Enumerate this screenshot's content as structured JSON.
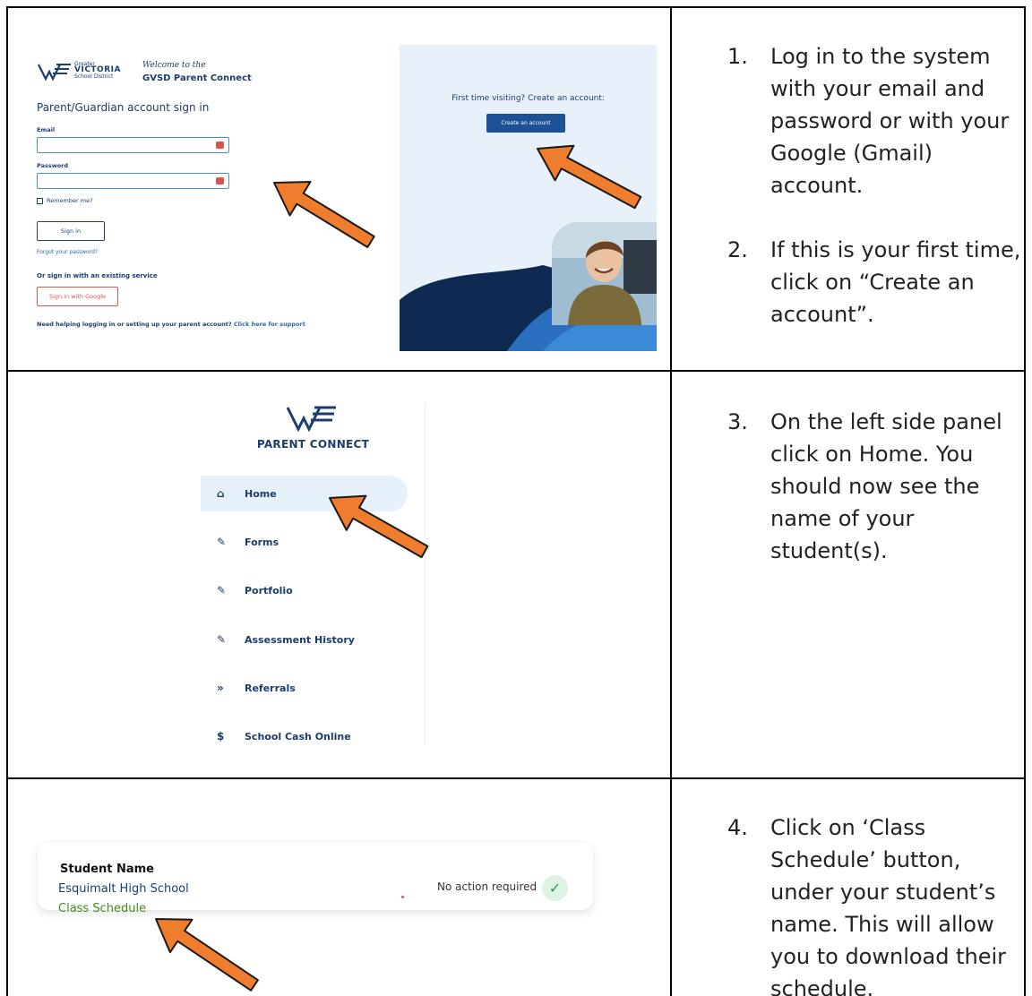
{
  "colors": {
    "arrow_fill": "#ef7d2d",
    "arrow_stroke": "#1a1a1a",
    "navy": "#1c3d6e",
    "google_red": "#d9534f",
    "create_button": "#1c5196",
    "schedule_green": "#3f8b1f"
  },
  "steps": [
    {
      "num": "1.",
      "text": "Log in to the system with your email and password or with your Google (Gmail) account."
    },
    {
      "num": "2.",
      "text": "If this is your first time, click on “Create an account”."
    },
    {
      "num": "3.",
      "text": "On the left side panel click on Home. You should now see the name of your student(s)."
    },
    {
      "num": "4.",
      "text": "Click on ‘Class Schedule’ button, under your student’s name. This will allow you to download their schedule."
    }
  ],
  "login": {
    "brand_line1": "Greater",
    "brand_line2": "VICTORIA",
    "brand_line3": "School District",
    "welcome": "Welcome to the",
    "portal": "GVSD Parent Connect",
    "title": "Parent/Guardian account sign in",
    "email_label": "Email",
    "password_label": "Password",
    "remember": "Remember me?",
    "sign_in": "Sign in",
    "forgot": "Forgot your password?",
    "or_service": "Or sign in with an existing service",
    "google": "Sign in with Google",
    "help": "Need helping logging in or setting up your parent account?",
    "help_link": "Click here for support",
    "first_time": "First time visiting? Create an account:",
    "create": "Create an account"
  },
  "nav": {
    "title": "PARENT CONNECT",
    "items": [
      {
        "label": "Home",
        "icon": "home-icon"
      },
      {
        "label": "Forms",
        "icon": "pencil-icon"
      },
      {
        "label": "Portfolio",
        "icon": "pencil-icon"
      },
      {
        "label": "Assessment History",
        "icon": "pencil-icon"
      },
      {
        "label": "Referrals",
        "icon": "double-chevron-icon"
      },
      {
        "label": "School Cash Online",
        "icon": "dollar-icon"
      }
    ]
  },
  "student_card": {
    "name": "Student Name",
    "school": "Esquimalt High School",
    "schedule": "Class Schedule",
    "status": "No action required"
  }
}
